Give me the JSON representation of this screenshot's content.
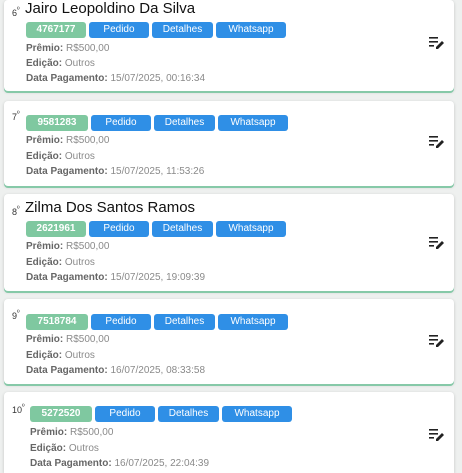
{
  "labels": {
    "premio": "Prêmio:",
    "edicao": "Edição:",
    "data_pagamento": "Data Pagamento:",
    "pedido": "Pedido",
    "detalhes": "Detalhes",
    "whatsapp": "Whatsapp"
  },
  "cards": [
    {
      "rank": "6",
      "sup": "º",
      "name": "Jairo Leopoldino Da Silva",
      "id": "4767177",
      "premio": "R$500,00",
      "edicao": "Outros",
      "data_pagamento": "15/07/2025, 00:16:34"
    },
    {
      "rank": "7",
      "sup": "º",
      "name": "",
      "id": "9581283",
      "premio": "R$500,00",
      "edicao": "Outros",
      "data_pagamento": "15/07/2025, 11:53:26"
    },
    {
      "rank": "8",
      "sup": "º",
      "name": "Zilma Dos Santos Ramos",
      "id": "2621961",
      "premio": "R$500,00",
      "edicao": "Outros",
      "data_pagamento": "15/07/2025, 19:09:39"
    },
    {
      "rank": "9",
      "sup": "º",
      "name": "",
      "id": "7518784",
      "premio": "R$500,00",
      "edicao": "Outros",
      "data_pagamento": "16/07/2025, 08:33:58"
    },
    {
      "rank": "10",
      "sup": "º",
      "name": "",
      "id": "5272520",
      "premio": "R$500,00",
      "edicao": "Outros",
      "data_pagamento": "16/07/2025, 22:04:39"
    }
  ],
  "colors": {
    "id_badge": "#7fc8a0",
    "button": "#2f8fe6",
    "card_accent": "#86c9a8"
  },
  "icons": {
    "edit": "edit-note-icon"
  }
}
